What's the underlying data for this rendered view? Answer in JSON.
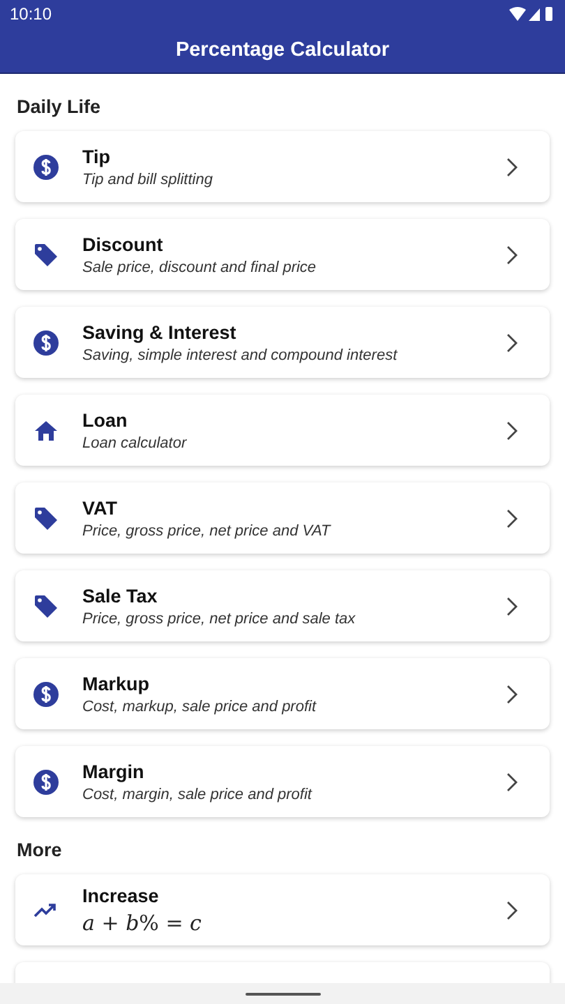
{
  "status_bar": {
    "time": "10:10"
  },
  "app_bar": {
    "title": "Percentage Calculator"
  },
  "sections": [
    {
      "title": "Daily Life",
      "items": [
        {
          "title": "Tip",
          "subtitle": "Tip and bill splitting",
          "kind": "text"
        },
        {
          "title": "Discount",
          "subtitle": "Sale price, discount and final price",
          "kind": "text"
        },
        {
          "title": "Saving & Interest",
          "subtitle": "Saving, simple interest and compound interest",
          "kind": "text"
        },
        {
          "title": "Loan",
          "subtitle": "Loan calculator",
          "kind": "text"
        },
        {
          "title": "VAT",
          "subtitle": "Price, gross price, net price and VAT",
          "kind": "text"
        },
        {
          "title": "Sale Tax",
          "subtitle": "Price, gross price, net price and sale tax",
          "kind": "text"
        },
        {
          "title": "Markup",
          "subtitle": "Cost, markup, sale price and profit",
          "kind": "text"
        },
        {
          "title": "Margin",
          "subtitle": "Cost, margin, sale price and profit",
          "kind": "text"
        }
      ]
    },
    {
      "title": "More",
      "items": [
        {
          "title": "Increase",
          "subtitle": "*a* + *b*% = *c*",
          "kind": "formula"
        }
      ]
    }
  ]
}
